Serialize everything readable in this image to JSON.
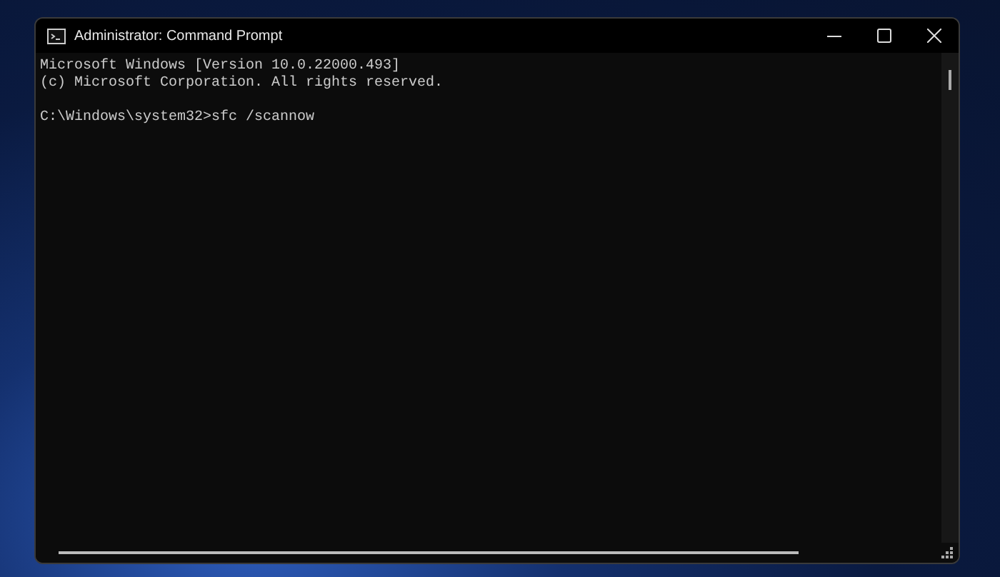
{
  "window": {
    "title": "Administrator: Command Prompt"
  },
  "console": {
    "lines": [
      {
        "kind": "output",
        "text": "Microsoft Windows [Version 10.0.22000.493]"
      },
      {
        "kind": "output",
        "text": "(c) Microsoft Corporation. All rights reserved."
      },
      {
        "kind": "prompt",
        "text": "C:\\Windows\\system32>sfc /scannow"
      }
    ]
  }
}
